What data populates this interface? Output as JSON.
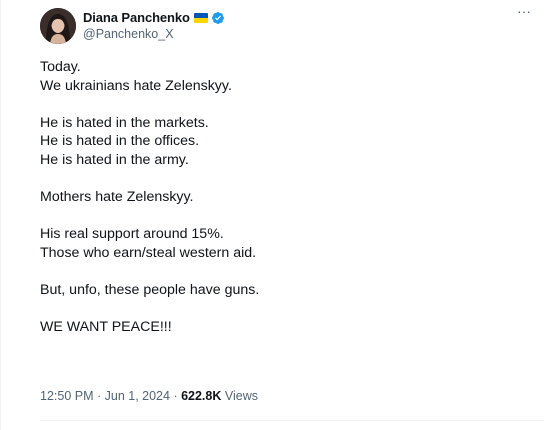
{
  "author": {
    "display_name": "Diana Panchenko",
    "handle": "@Panchenko_X",
    "flag_icon": "ukraine-flag-icon",
    "verified_icon": "verified-badge-icon",
    "verified_color": "#1d9bf0"
  },
  "more_icon_glyph": "···",
  "tweet": {
    "text": "Today.\nWe ukrainians hate Zelenskyy.\n\nHe is hated in the markets.\nHe is hated in the offices.\nHe is hated in the army.\n\nMothers hate Zelenskyy.\n\nHis real support around 15%.\nThose who earn/steal western aid.\n\nBut, unfo, these people have guns.\n\nWE WANT PEACE!!!"
  },
  "meta": {
    "time": "12:50 PM",
    "separator": " · ",
    "date": "Jun 1, 2024",
    "views_count": "622.8K",
    "views_label": " Views"
  },
  "colors": {
    "text": "#0f1419",
    "secondary": "#536471",
    "divider": "#eff3f4",
    "flag_blue": "#0057b7",
    "flag_yellow": "#ffd500"
  }
}
